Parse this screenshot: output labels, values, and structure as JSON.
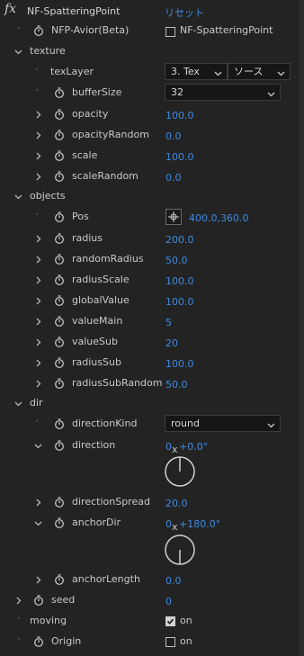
{
  "effect": {
    "fx_label": "fx",
    "name": "NF-SpatteringPoint",
    "reset_label": "リセット"
  },
  "avior": {
    "label": "NFP-Avior(Beta)",
    "checkbox_label": "NF-SpatteringPoint",
    "checked": false
  },
  "texture": {
    "group_label": "texture",
    "texlayer": {
      "label": "texLayer",
      "layer_value": "3. Tex",
      "source_value": "ソース"
    },
    "buffersize": {
      "label": "bufferSize",
      "value": "32"
    },
    "opacity": {
      "label": "opacity",
      "value": "100.0"
    },
    "opacityrandom": {
      "label": "opacityRandom",
      "value": "0.0"
    },
    "scale": {
      "label": "scale",
      "value": "100.0"
    },
    "scalerandom": {
      "label": "scaleRandom",
      "value": "0.0"
    }
  },
  "objects": {
    "group_label": "objects",
    "pos": {
      "label": "Pos",
      "value": "400.0,360.0"
    },
    "radius": {
      "label": "radius",
      "value": "200.0"
    },
    "randomradius": {
      "label": "randomRadius",
      "value": "50.0"
    },
    "radiusscale": {
      "label": "radiusScale",
      "value": "100.0"
    },
    "globalvalue": {
      "label": "globalValue",
      "value": "100.0"
    },
    "valuemain": {
      "label": "valueMain",
      "value": "5"
    },
    "valuesub": {
      "label": "valueSub",
      "value": "20"
    },
    "radiussub": {
      "label": "radiusSub",
      "value": "100.0"
    },
    "radiussubrandom": {
      "label": "radiusSubRandom",
      "value": "50.0"
    }
  },
  "dir": {
    "group_label": "dir",
    "directionkind": {
      "label": "directionKind",
      "value": "round"
    },
    "direction": {
      "label": "direction",
      "revolutions": "0",
      "angle": "+0.0°",
      "angle_deg": 0
    },
    "directionspread": {
      "label": "directionSpread",
      "value": "20.0"
    },
    "anchordir": {
      "label": "anchorDir",
      "revolutions": "0",
      "angle": "+180.0°",
      "angle_deg": 180
    },
    "anchorlength": {
      "label": "anchorLength",
      "value": "0.0"
    }
  },
  "seed": {
    "label": "seed",
    "value": "0"
  },
  "moving": {
    "label": "moving",
    "checkbox_label": "on",
    "checked": true
  },
  "origin": {
    "label": "Origin",
    "checkbox_label": "on",
    "checked": false
  },
  "colors": {
    "accent_value": "#3d8be4",
    "background": "#232323",
    "field_bg": "#161616"
  }
}
